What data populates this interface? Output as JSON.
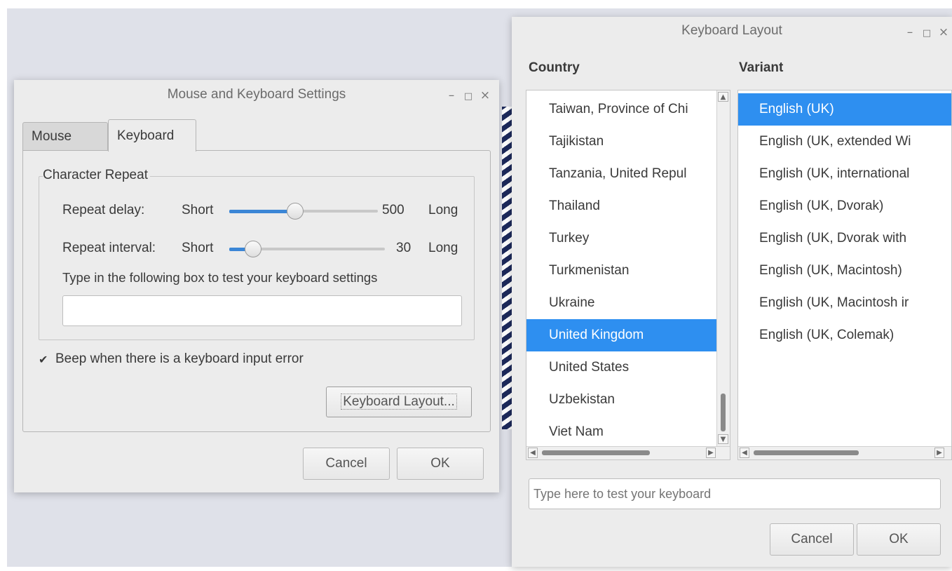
{
  "mouse_kb_window": {
    "title": "Mouse and Keyboard Settings",
    "controls": {
      "minimize": "–",
      "maximize": "□",
      "close": "×"
    },
    "tabs": [
      {
        "label": "Mouse",
        "active": false
      },
      {
        "label": "Keyboard",
        "active": true
      }
    ],
    "group_title": "Character Repeat",
    "repeat_delay": {
      "label": "Repeat delay:",
      "min_label": "Short",
      "value": "500",
      "max_label": "Long"
    },
    "repeat_interval": {
      "label": "Repeat interval:",
      "min_label": "Short",
      "value": "30",
      "max_label": "Long"
    },
    "test_prompt": "Type in the following box to test your keyboard settings",
    "test_input_value": "",
    "beep_checkbox": {
      "label": "Beep when there is a keyboard input error",
      "checked": true,
      "mark": "✔"
    },
    "keyboard_layout_button": "Keyboard Layout...",
    "cancel_button": "Cancel",
    "ok_button": "OK"
  },
  "layout_window": {
    "title": "Keyboard Layout",
    "controls": {
      "minimize": "–",
      "maximize": "□",
      "close": "×"
    },
    "country_header": "Country",
    "variant_header": "Variant",
    "countries": [
      "Taiwan, Province of Chi",
      "Tajikistan",
      "Tanzania, United Repul",
      "Thailand",
      "Turkey",
      "Turkmenistan",
      "Ukraine",
      "United Kingdom",
      "United States",
      "Uzbekistan",
      "Viet Nam"
    ],
    "selected_country": "United Kingdom",
    "variants": [
      "English (UK)",
      "English (UK, extended Wi",
      "English (UK, international",
      "English (UK, Dvorak)",
      "English (UK, Dvorak with",
      "English (UK, Macintosh)",
      "English (UK, Macintosh ir",
      "English (UK, Colemak)"
    ],
    "selected_variant": "English (UK)",
    "test_input_placeholder": "Type here to test your keyboard",
    "cancel_button": "Cancel",
    "ok_button": "OK"
  },
  "colors": {
    "selection": "#2e8ff0",
    "slider_fill": "#3b86d6",
    "window_bg": "#ececec",
    "desktop_bg": "#dfe1e9"
  }
}
